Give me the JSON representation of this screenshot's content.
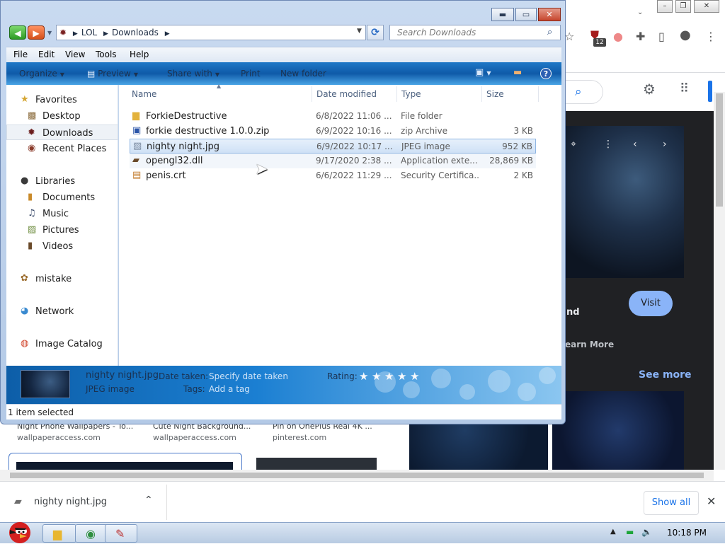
{
  "browser": {
    "extension_badge": "12",
    "visit_label": "Visit",
    "partial_title": "nd",
    "learn_more": "earn More",
    "see_more": "See more",
    "captions": [
      "Night Phone Wallpapers - To...",
      "Cute Night Background...",
      "Pin on OnePlus Real 4K ..."
    ],
    "sources": [
      "wallpaperaccess.com",
      "wallpaperaccess.com",
      "pinterest.com"
    ]
  },
  "downloads_bar": {
    "file_name": "nighty night.jpg",
    "show_all_label": "Show all"
  },
  "taskbar": {
    "clock": "10:18 PM"
  },
  "explorer": {
    "breadcrumb": [
      "LOL",
      "Downloads"
    ],
    "search_placeholder": "Search Downloads",
    "menu": [
      "File",
      "Edit",
      "View",
      "Tools",
      "Help"
    ],
    "commands": {
      "organize": "Organize",
      "preview": "Preview",
      "share_with": "Share with",
      "print": "Print",
      "new_folder": "New folder"
    },
    "nav": {
      "favorites": "Favorites",
      "desktop": "Desktop",
      "downloads": "Downloads",
      "recent": "Recent Places",
      "libraries": "Libraries",
      "documents": "Documents",
      "music": "Music",
      "pictures": "Pictures",
      "videos": "Videos",
      "mistake": "mistake",
      "network": "Network",
      "image_catalog": "Image Catalog"
    },
    "columns": {
      "name": "Name",
      "date": "Date modified",
      "type": "Type",
      "size": "Size"
    },
    "files": [
      {
        "name": "ForkieDestructive",
        "date": "6/8/2022 11:06 ...",
        "type": "File folder",
        "size": "",
        "icon": "folder-icon"
      },
      {
        "name": "forkie destructive 1.0.0.zip",
        "date": "6/9/2022 10:16 ...",
        "type": "zip Archive",
        "size": "3 KB",
        "icon": "zip-icon"
      },
      {
        "name": "nighty night.jpg",
        "date": "6/9/2022 10:17 ...",
        "type": "JPEG image",
        "size": "952 KB",
        "icon": "image-icon"
      },
      {
        "name": "opengl32.dll",
        "date": "9/17/2020 2:38 ...",
        "type": "Application exte...",
        "size": "28,869 KB",
        "icon": "dll-icon"
      },
      {
        "name": "penis.crt",
        "date": "6/6/2022 11:29 ...",
        "type": "Security Certifica...",
        "size": "2 KB",
        "icon": "certificate-icon"
      }
    ],
    "details": {
      "file_name": "nighty night.jpg",
      "file_type": "JPEG image",
      "date_taken_label": "Date taken:",
      "date_taken_value": "Specify date taken",
      "tags_label": "Tags:",
      "tags_value": "Add a tag",
      "rating_label": "Rating:",
      "rating_value": 0,
      "rating_max": 5
    },
    "status": "1 item selected"
  }
}
